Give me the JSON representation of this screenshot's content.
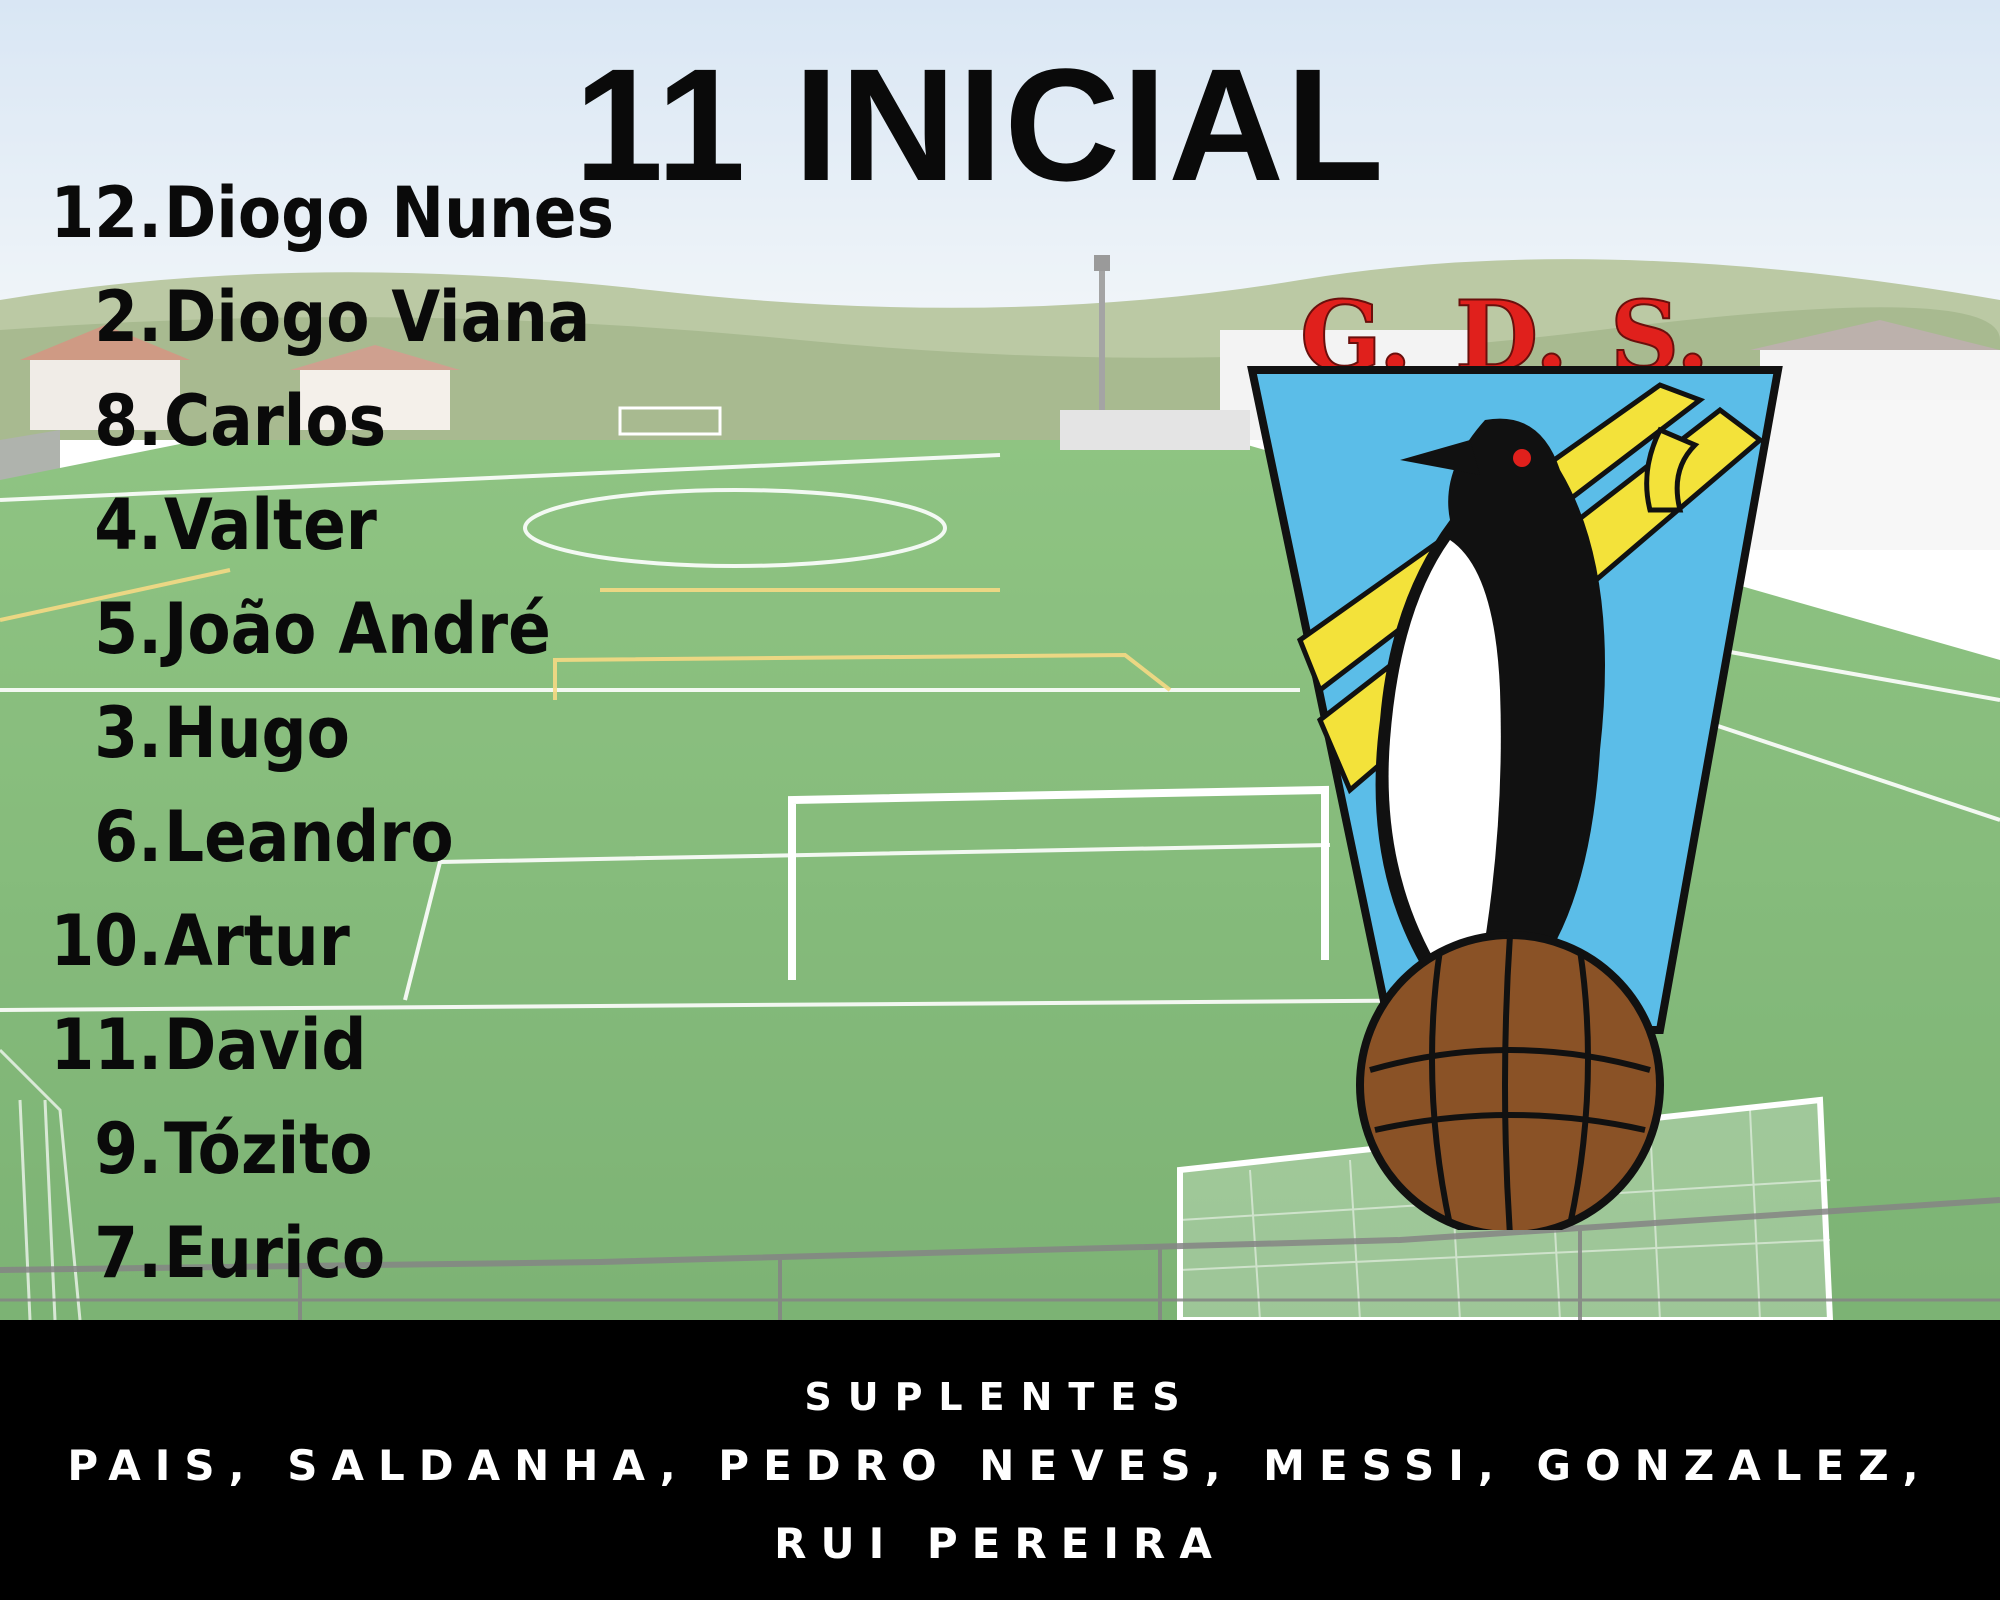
{
  "title": "11 INICIAL",
  "lineup": [
    {
      "number": "12.",
      "name": "Diogo Nunes"
    },
    {
      "number": "2.",
      "name": "Diogo Viana"
    },
    {
      "number": "8.",
      "name": "Carlos"
    },
    {
      "number": "4.",
      "name": "Valter"
    },
    {
      "number": "5.",
      "name": "João André"
    },
    {
      "number": "3.",
      "name": "Hugo"
    },
    {
      "number": "6.",
      "name": "Leandro"
    },
    {
      "number": "10.",
      "name": "Artur"
    },
    {
      "number": "11.",
      "name": "David"
    },
    {
      "number": "9.",
      "name": "Tózito"
    },
    {
      "number": "7.",
      "name": "Eurico"
    }
  ],
  "substitutes": {
    "heading": "SUPLENTES",
    "line1": "PAIS, SALDANHA, PEDRO NEVES, MESSI, GONZALEZ,",
    "line2": "RUI PEREIRA"
  },
  "crest": {
    "letters": [
      "G.",
      "D.",
      "S."
    ],
    "icon": "penguin-on-football-crest",
    "colors": {
      "letters": "#e0201c",
      "sky": "#5bbde8",
      "stripe": "#f3e23a",
      "ball": "#8a5226",
      "outline": "#111111"
    }
  },
  "background": {
    "icon": "football-pitch-photo",
    "colors": {
      "grass": "#4c9a3a",
      "sky": "#d9e6f2"
    }
  },
  "colors": {
    "footer": "#000000",
    "text_dark": "#0a0a0a",
    "text_light": "#ffffff"
  }
}
